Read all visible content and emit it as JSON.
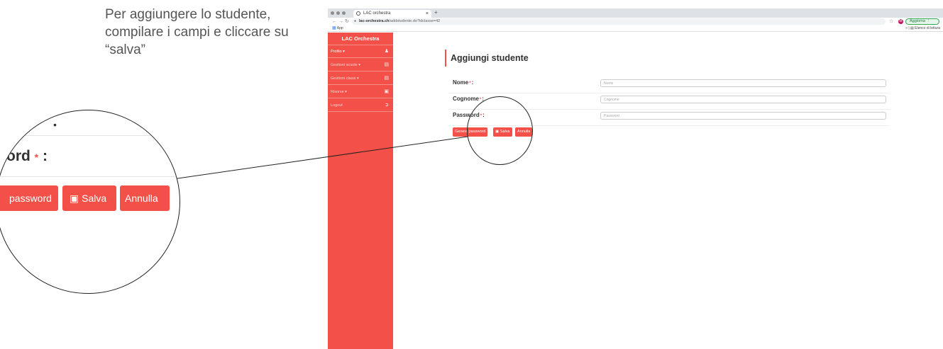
{
  "instruction": "Per aggiungere lo studente, compilare i campi e cliccare su “salva”",
  "browser": {
    "tab_title": "LAC orchestra",
    "tab_close": "×",
    "new_tab": "+",
    "url_host": "lac-orchestra.ch",
    "url_path": "/addstudente.do?idclasse=42",
    "avatar_initial": "M",
    "update_label": "Aggiorna",
    "apps_label": "App",
    "reading_list_label": "Elenco di lettura"
  },
  "sidebar": {
    "brand": "LAC Orchestra",
    "items": [
      {
        "label": "Profilo ▾",
        "icon": "user-icon",
        "active": true
      },
      {
        "label": "Gestioni scuole ▾",
        "icon": "book-icon",
        "active": false
      },
      {
        "label": "Gestioni classi ▾",
        "icon": "book-icon",
        "active": false
      },
      {
        "label": "Risorse ▾",
        "icon": "briefcase-icon",
        "active": false
      },
      {
        "label": "Logout",
        "icon": "logout-icon",
        "active": false
      }
    ]
  },
  "main": {
    "title": "Aggiungi studente",
    "fields": [
      {
        "label": "Nome",
        "placeholder": "Nome"
      },
      {
        "label": "Cognome",
        "placeholder": "Cognome"
      },
      {
        "label": "Password",
        "placeholder": "Password"
      }
    ],
    "required_mark": "*",
    "buttons": {
      "generate": "Genera password",
      "save": "Salva",
      "cancel": "Annulla"
    }
  },
  "magnifier": {
    "label_fragment": "ord",
    "generate_fragment": "password",
    "save": "Salva",
    "cancel": "Annulla"
  },
  "colors": {
    "accent": "#f25048"
  }
}
